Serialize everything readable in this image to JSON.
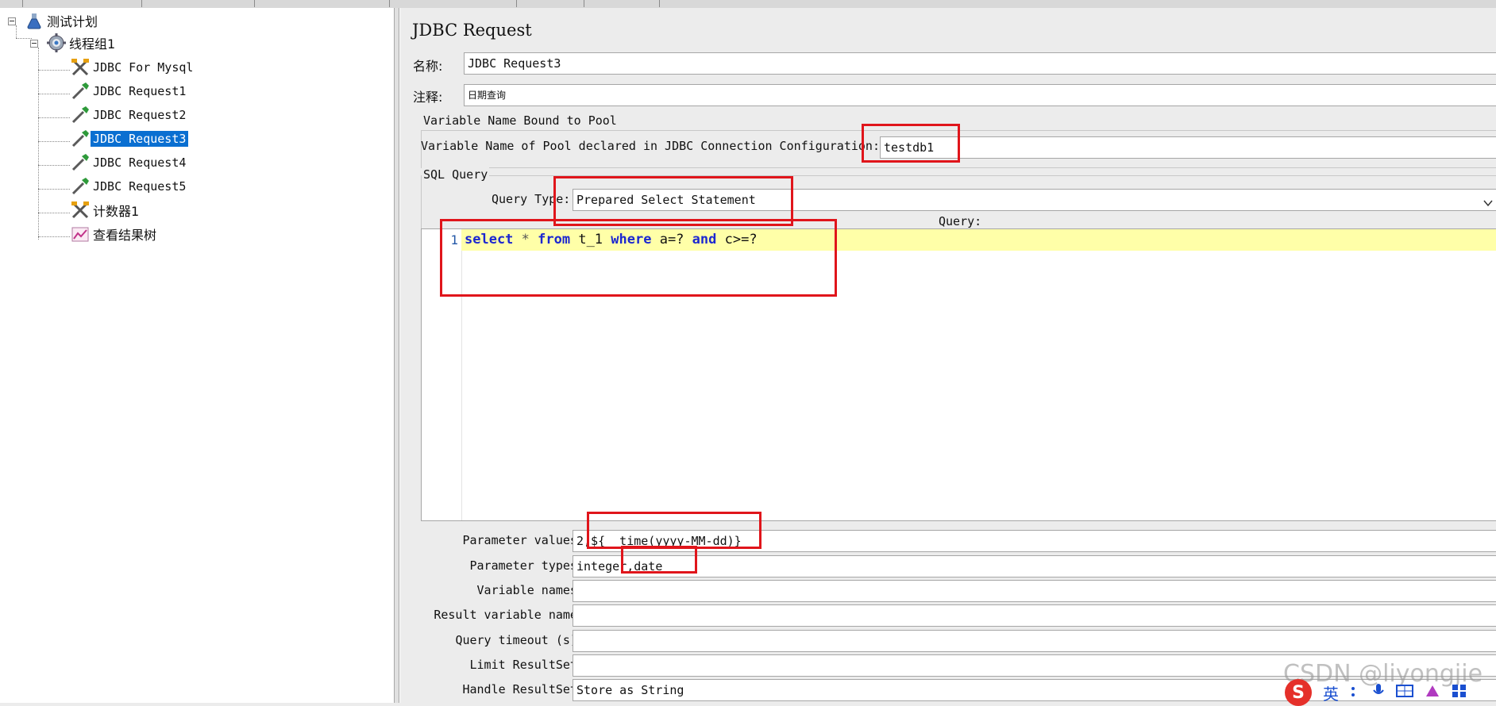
{
  "tree": {
    "nodes": [
      {
        "label": "测试计划",
        "icon": "test-plan-flask-icon"
      },
      {
        "label": "线程组1",
        "icon": "thread-group-gear-icon"
      },
      {
        "label": "JDBC For Mysql",
        "icon": "config-element-scissors-icon"
      },
      {
        "label": "JDBC Request1",
        "icon": "sampler-pipette-icon"
      },
      {
        "label": "JDBC Request2",
        "icon": "sampler-pipette-icon"
      },
      {
        "label": "JDBC Request3",
        "icon": "sampler-pipette-icon",
        "selected": true
      },
      {
        "label": "JDBC Request4",
        "icon": "sampler-pipette-icon"
      },
      {
        "label": "JDBC Request5",
        "icon": "sampler-pipette-icon"
      },
      {
        "label": "计数器1",
        "icon": "config-element-scissors-icon"
      },
      {
        "label": "查看结果树",
        "icon": "listener-chart-icon"
      }
    ]
  },
  "panel": {
    "title": "JDBC Request",
    "name_label": "名称:",
    "name_value": "JDBC Request3",
    "comment_label": "注释:",
    "comment_value": "日期查询"
  },
  "pool_group": {
    "title": "Variable Name Bound to Pool",
    "label": "Variable Name of Pool declared in JDBC Connection Configuration:",
    "value": "testdb1"
  },
  "sql_group": {
    "title": "SQL Query",
    "query_type_label": "Query Type:",
    "query_type_value": "Prepared Select Statement",
    "query_label": "Query:",
    "line_number": "1",
    "code_tokens": {
      "t1": "select",
      "t2": " * ",
      "t3": "from",
      "t4": " t_1 ",
      "t5": "where",
      "t6": " a=? ",
      "t7": "and",
      "t8": " c>=?"
    }
  },
  "params": {
    "values_label": "Parameter values:",
    "values_value": "2,${__time(yyyy-MM-dd)}",
    "types_label": "Parameter types:",
    "types_value": "integer,date",
    "varnames_label": "Variable names:",
    "varnames_value": "",
    "result_label": "Result variable name:",
    "result_value": "",
    "timeout_label": "Query timeout (s):",
    "timeout_value": "",
    "limit_label": "Limit ResultSet:",
    "limit_value": "",
    "handle_label": "Handle ResultSet:",
    "handle_value": "Store as String"
  },
  "overlay": {
    "watermark": "CSDN @liyongjie",
    "ime_logo": "S",
    "ime_mode": "英"
  },
  "colors": {
    "selection": "#0a6fd1",
    "highlight_box": "#e0151b",
    "keyword": "#1c27d0",
    "current_line": "#ffffa8"
  }
}
